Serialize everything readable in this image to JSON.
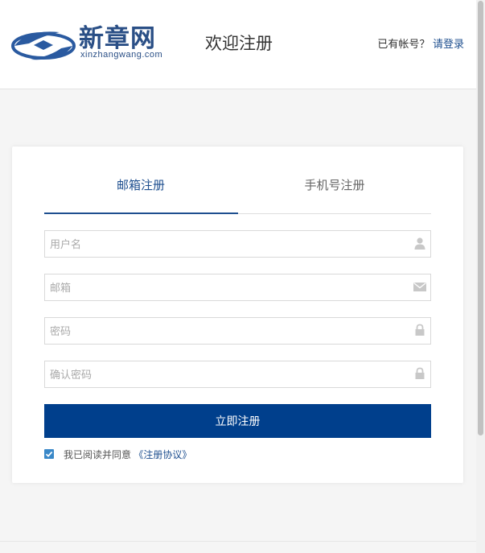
{
  "header": {
    "brand_text": "新章网",
    "brand_domain": "xinzhangwang.com",
    "welcome": "欢迎注册",
    "login_hint_prefix": "已有帐号？",
    "login_link": "请登录"
  },
  "tabs": [
    {
      "label": "邮箱注册",
      "active": true
    },
    {
      "label": "手机号注册",
      "active": false
    }
  ],
  "form": {
    "username_placeholder": "用户名",
    "email_placeholder": "邮箱",
    "password_placeholder": "密码",
    "confirm_password_placeholder": "确认密码",
    "submit_label": "立即注册",
    "agree_text": "我已阅读并同意",
    "agreement_link": "《注册协议》",
    "agree_checked": true
  },
  "colors": {
    "brand": "#1e4f8f",
    "submit_bg": "#003f8c",
    "checkbox": "#3a88c8"
  },
  "icons": [
    "logo-swirl-icon",
    "user-icon",
    "envelope-icon",
    "lock-icon",
    "lock-icon",
    "checkbox-checked-icon"
  ]
}
